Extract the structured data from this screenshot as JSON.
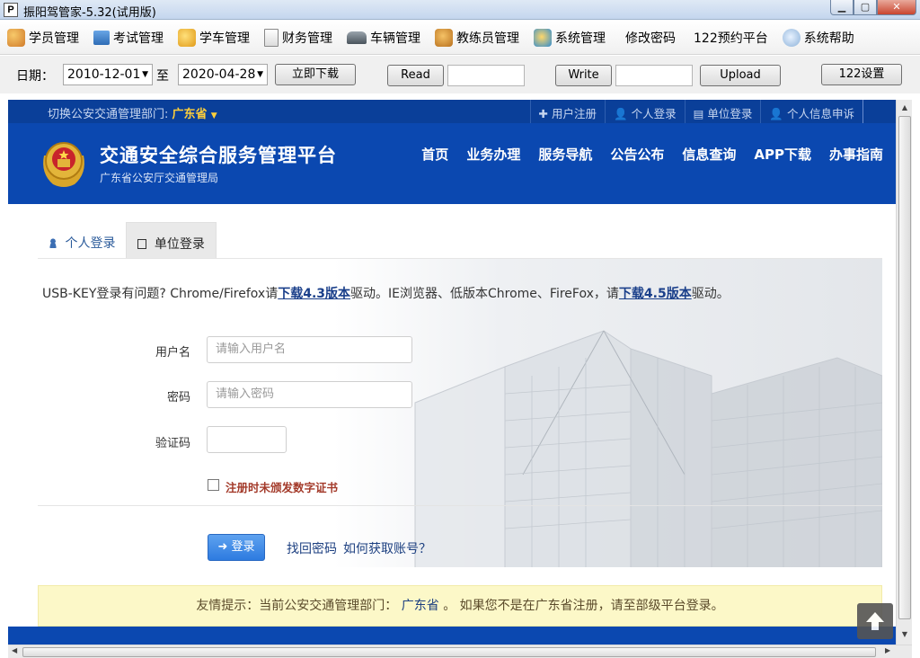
{
  "window": {
    "title": "振阳驾管家-5.32(试用版)",
    "app_icon": "P"
  },
  "menu": [
    {
      "label": "学员管理",
      "icon": "students-icon"
    },
    {
      "label": "考试管理",
      "icon": "exam-icon"
    },
    {
      "label": "学车管理",
      "icon": "learn-driving-icon"
    },
    {
      "label": "财务管理",
      "icon": "finance-icon"
    },
    {
      "label": "车辆管理",
      "icon": "vehicle-icon"
    },
    {
      "label": "教练员管理",
      "icon": "coach-icon"
    },
    {
      "label": "系统管理",
      "icon": "system-icon"
    },
    {
      "label": "修改密码"
    },
    {
      "label": "122预约平台"
    },
    {
      "label": "系统帮助",
      "icon": "help-icon"
    }
  ],
  "toolbar": {
    "date_label": "日期：",
    "start_date": "2010-12-01",
    "to_label": "至",
    "end_date": "2020-04-28",
    "download_label": "立即下载",
    "read_label": "Read",
    "write_label": "Write",
    "upload_label": "Upload",
    "settings_label": "122设置"
  },
  "site": {
    "dept_switch_label": "切换公安交通管理部门:",
    "dept_name": "广东省",
    "top_links": [
      "用户注册",
      "个人登录",
      "单位登录",
      "个人信息申诉"
    ],
    "title": "交通安全综合服务管理平台",
    "subtitle": "广东省公安厅交通管理局",
    "nav": [
      "首页",
      "业务办理",
      "服务导航",
      "公告公布",
      "信息查询",
      "APP下载",
      "办事指南"
    ]
  },
  "login": {
    "tabs": [
      "个人登录",
      "单位登录"
    ],
    "notice_prefix": "USB-KEY登录有问题? Chrome/Firefox请",
    "notice_link1": "下载4.3版本",
    "notice_middle": "驱动。IE浏览器、低版本Chrome、FireFox，请",
    "notice_link2": "下载4.5版本",
    "notice_suffix": "驱动。",
    "username_label": "用户名",
    "username_placeholder": "请输入用户名",
    "password_label": "密码",
    "password_placeholder": "请输入密码",
    "captcha_label": "验证码",
    "cert_label": "注册时未颁发数字证书",
    "login_button": "登录",
    "forgot_password": "找回密码",
    "get_account": "如何获取账号？"
  },
  "tip": {
    "prefix": "友情提示：当前公安交通管理部门：",
    "dept": "广东省",
    "suffix": "。 如果您不是在广东省注册，请至部级平台登录。"
  },
  "colors": {
    "site_blue": "#0b48b0",
    "dept_yellow": "#ffcf3a",
    "login_blue": "#2d7be0",
    "tip_bg": "#fcf8c8"
  }
}
